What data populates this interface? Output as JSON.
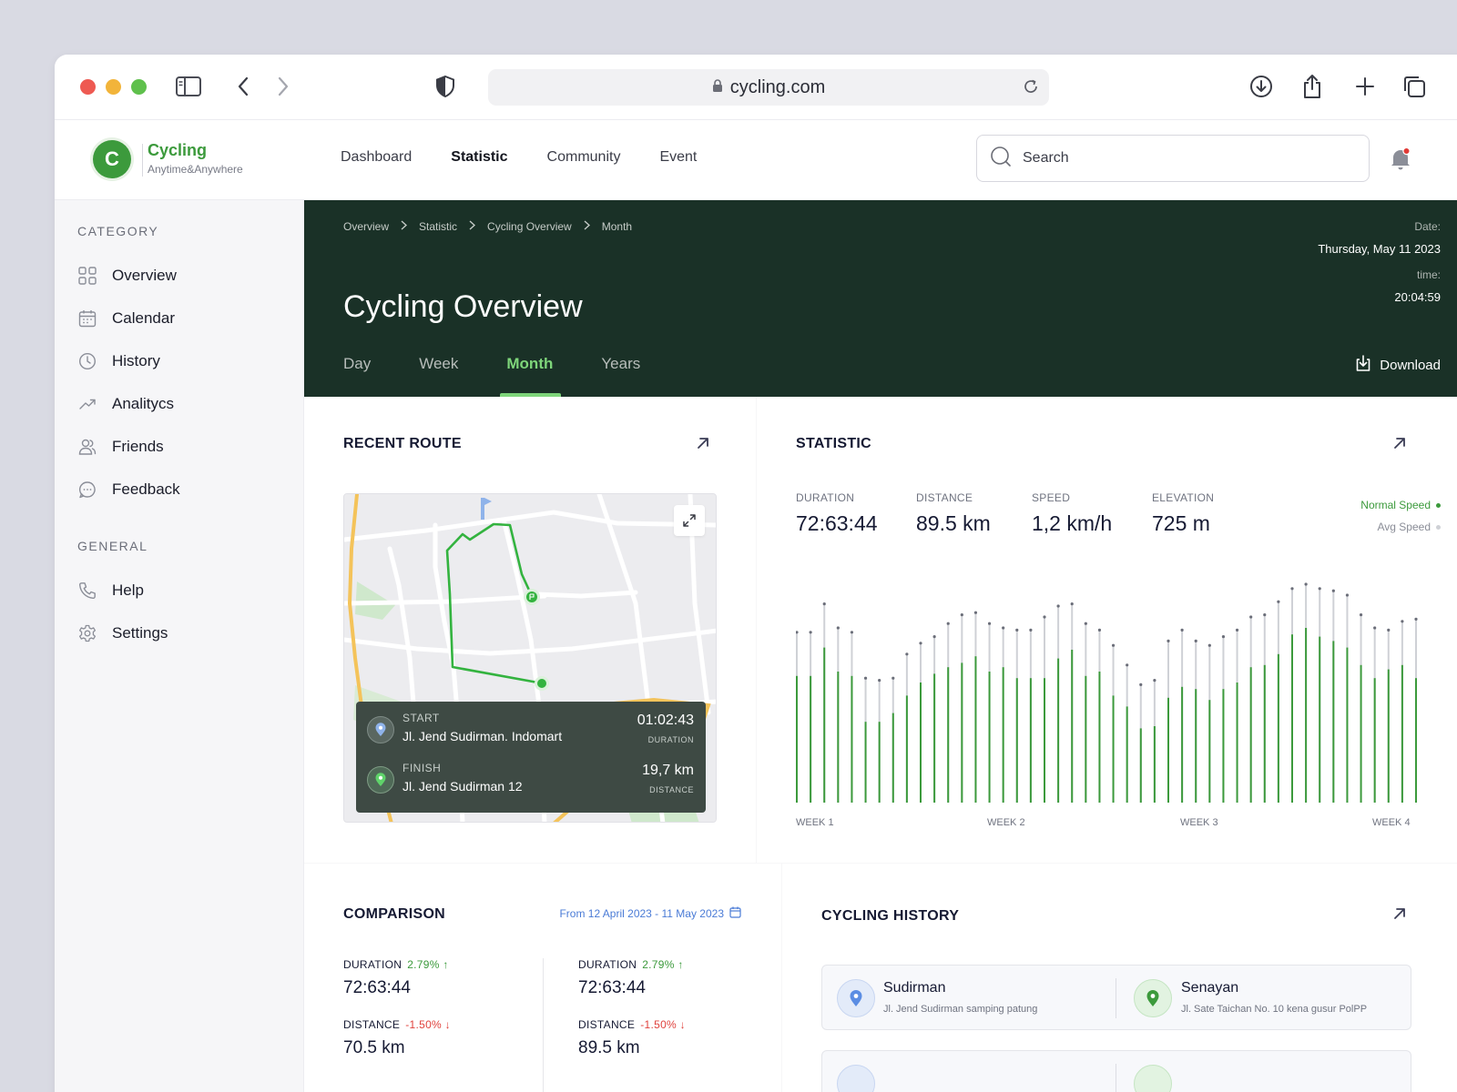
{
  "browser": {
    "url": "cycling.com"
  },
  "app": {
    "logo_letter": "C",
    "name": "Cycling",
    "tagline": "Anytime&Anywhere",
    "nav": [
      "Dashboard",
      "Statistic",
      "Community",
      "Event"
    ],
    "nav_active": "Statistic",
    "search_placeholder": "Search"
  },
  "sidebar": {
    "category_title": "CATEGORY",
    "category_items": [
      {
        "label": "Overview",
        "icon": "grid-icon"
      },
      {
        "label": "Calendar",
        "icon": "calendar-icon"
      },
      {
        "label": "History",
        "icon": "clock-icon"
      },
      {
        "label": "Analitycs",
        "icon": "trend-icon"
      },
      {
        "label": "Friends",
        "icon": "users-icon"
      },
      {
        "label": "Feedback",
        "icon": "chat-icon"
      }
    ],
    "general_title": "GENERAL",
    "general_items": [
      {
        "label": "Help",
        "icon": "phone-icon"
      },
      {
        "label": "Settings",
        "icon": "gear-icon"
      }
    ]
  },
  "hero": {
    "breadcrumbs": [
      "Overview",
      "Statistic",
      "Cycling Overview",
      "Month"
    ],
    "title": "Cycling Overview",
    "date_label": "Date:",
    "date_value": "Thursday, May 11 2023",
    "time_label": "time:",
    "time_value": "20:04:59",
    "tabs": [
      "Day",
      "Week",
      "Month",
      "Years"
    ],
    "active_tab": "Month",
    "download_label": "Download"
  },
  "recent_route": {
    "title": "RECENT ROUTE",
    "start_label": "START",
    "start_place": "Jl. Jend Sudirman. Indomart",
    "duration_value": "01:02:43",
    "duration_label": "DURATION",
    "finish_label": "FINISH",
    "finish_place": "Jl. Jend Sudirman 12",
    "distance_value": "19,7 km",
    "distance_label": "DISTANCE"
  },
  "statistic": {
    "title": "STATISTIC",
    "metrics": [
      {
        "label": "DURATION",
        "value": "72:63:44"
      },
      {
        "label": "DISTANCE",
        "value": "89.5 km"
      },
      {
        "label": "SPEED",
        "value": "1,2 km/h"
      },
      {
        "label": "ELEVATION",
        "value": "725 m"
      }
    ],
    "legend_normal": "Normal Speed",
    "legend_avg": "Avg Speed",
    "colors": {
      "normal": "#3c9a3c",
      "avg": "#cfd1d6"
    },
    "week_labels": [
      "WEEK 1",
      "WEEK 2",
      "WEEK 3",
      "WEEK 4"
    ]
  },
  "chart_data": {
    "type": "bar",
    "series": [
      {
        "name": "Normal Speed",
        "values": [
          0.58,
          0.58,
          0.71,
          0.6,
          0.58,
          0.37,
          0.37,
          0.41,
          0.49,
          0.55,
          0.59,
          0.62,
          0.64,
          0.67,
          0.6,
          0.62,
          0.57,
          0.57,
          0.57,
          0.66,
          0.7,
          0.58,
          0.6,
          0.49,
          0.44,
          0.34,
          0.35,
          0.48,
          0.53,
          0.52,
          0.47,
          0.52,
          0.55,
          0.62,
          0.63,
          0.68,
          0.77,
          0.8,
          0.76,
          0.74,
          0.71,
          0.63,
          0.57,
          0.61,
          0.63,
          0.57
        ]
      },
      {
        "name": "Avg Speed",
        "values": [
          0.78,
          0.78,
          0.91,
          0.8,
          0.78,
          0.57,
          0.56,
          0.57,
          0.68,
          0.73,
          0.76,
          0.82,
          0.86,
          0.87,
          0.82,
          0.8,
          0.79,
          0.79,
          0.85,
          0.9,
          0.91,
          0.82,
          0.79,
          0.72,
          0.63,
          0.54,
          0.56,
          0.74,
          0.79,
          0.74,
          0.72,
          0.76,
          0.79,
          0.85,
          0.86,
          0.92,
          0.98,
          1.0,
          0.98,
          0.97,
          0.95,
          0.86,
          0.8,
          0.79,
          0.83,
          0.84
        ]
      }
    ],
    "categories": [
      "WEEK 1",
      "WEEK 2",
      "WEEK 3",
      "WEEK 4"
    ]
  },
  "comparison": {
    "title": "COMPARISON",
    "date_range": "From 12 April 2023 - 11 May 2023",
    "columns": [
      {
        "duration_label": "DURATION",
        "duration_change": "2.79% ↑",
        "duration_value": "72:63:44",
        "distance_label": "DISTANCE",
        "distance_change": "-1.50% ↓",
        "distance_value": "70.5 km"
      },
      {
        "duration_label": "DURATION",
        "duration_change": "2.79% ↑",
        "duration_value": "72:63:44",
        "distance_label": "DISTANCE",
        "distance_change": "-1.50% ↓",
        "distance_value": "89.5 km"
      }
    ]
  },
  "history": {
    "title": "CYCLING HISTORY",
    "items": [
      {
        "from_name": "Sudirman",
        "from_addr": "Jl. Jend Sudirman samping patung",
        "to_name": "Senayan",
        "to_addr": "Jl. Sate Taichan No. 10 kena gusur PolPP"
      }
    ]
  }
}
